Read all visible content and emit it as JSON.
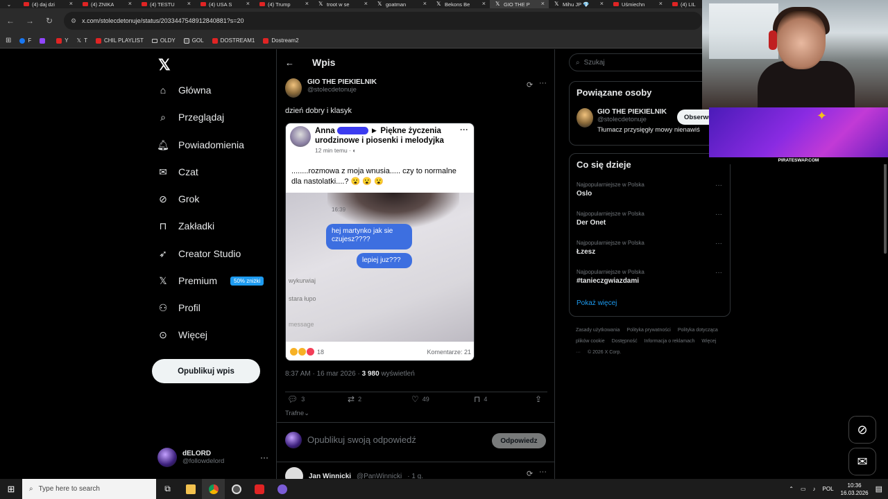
{
  "browser": {
    "tabs": [
      {
        "title": "(4) daj dzi",
        "icon": "youtube-icon"
      },
      {
        "title": "(4) ZNIKA",
        "icon": "youtube-icon"
      },
      {
        "title": "(4) TESTU",
        "icon": "youtube-icon"
      },
      {
        "title": "(4) USA S",
        "icon": "youtube-icon"
      },
      {
        "title": "(4) Trump",
        "icon": "youtube-icon"
      },
      {
        "title": "troot w se",
        "icon": "x-icon"
      },
      {
        "title": "goatman",
        "icon": "x-icon"
      },
      {
        "title": "Bekons Be",
        "icon": "x-icon"
      },
      {
        "title": "GIO THE P",
        "icon": "x-icon",
        "active": true
      },
      {
        "title": "Mihu JP 💎",
        "icon": "x-icon"
      },
      {
        "title": "Uśmiechn",
        "icon": "youtube-icon"
      },
      {
        "title": "(4) LIL",
        "icon": "youtube-icon"
      }
    ],
    "url": "x.com/stolecdetonuje/status/2033447548912840881?s=20",
    "bookmarks": [
      {
        "label": "F",
        "kind": "f"
      },
      {
        "label": "",
        "kind": "t"
      },
      {
        "label": "Y",
        "kind": "y"
      },
      {
        "label": "T",
        "kind": "x"
      },
      {
        "label": "CHIL PLAYLIST",
        "kind": "y"
      },
      {
        "label": "OLDY",
        "kind": "fold"
      },
      {
        "label": "GOL",
        "kind": "g"
      },
      {
        "label": "DOSTREAM1",
        "kind": "y"
      },
      {
        "label": "Dostream2",
        "kind": "y"
      }
    ]
  },
  "sidebar": {
    "items": [
      {
        "label": "Główna",
        "icon": "home-icon"
      },
      {
        "label": "Przeglądaj",
        "icon": "search-icon"
      },
      {
        "label": "Powiadomienia",
        "icon": "bell-icon"
      },
      {
        "label": "Czat",
        "icon": "mail-icon"
      },
      {
        "label": "Grok",
        "icon": "grok-icon"
      },
      {
        "label": "Zakładki",
        "icon": "bookmark-icon"
      },
      {
        "label": "Creator Studio",
        "icon": "rocket-icon"
      },
      {
        "label": "Premium",
        "icon": "x-icon",
        "badge": "50% zniżki"
      },
      {
        "label": "Profil",
        "icon": "person-icon"
      },
      {
        "label": "Więcej",
        "icon": "more-circle-icon"
      }
    ],
    "post_button": "Opublikuj wpis",
    "account": {
      "name": "dELORD",
      "handle": "@followdelord"
    }
  },
  "main": {
    "header_title": "Wpis",
    "post": {
      "author_name": "GIO THE PIEKIELNIK",
      "author_handle": "@stolecdetonuje",
      "text": "dzień dobry i klasyk",
      "embedded": {
        "fb_name": "Anna",
        "fb_group": "► Piękne życzenia urodzinowe i piosenki i melodyjka",
        "fb_time": "12 min temu · ◐",
        "fb_text": "........rozmowa z moja wnusia..... czy to normalne dla nastolatki....? 😮 😮 😮",
        "photo_time": "16:39",
        "bubble1": "hej martynko jak sie czujesz????",
        "bubble2": "lepiej juz???",
        "photo_line1": "wykurwiaj",
        "photo_line2": "stara  łupo",
        "photo_line3": "message",
        "reactions": "18",
        "comments": "Komentarze: 21"
      },
      "time": "8:37 AM · 16 mar 2026 ·",
      "views_count": "3 980",
      "views_label": "wyświetleń",
      "stats": {
        "replies": "3",
        "reposts": "2",
        "likes": "49",
        "bookmarks": "4"
      }
    },
    "sort_label": "Trafne",
    "reply_placeholder": "Opublikuj swoją odpowiedź",
    "reply_button": "Odpowiedz",
    "next_post": {
      "name": "Jan Winnicki",
      "handle": "@PanWinnicki",
      "time": "· 1 g."
    }
  },
  "right": {
    "search_placeholder": "Szukaj",
    "related_title": "Powiązane osoby",
    "related": {
      "name": "GIO THE PIEKIELNIK",
      "handle": "@stolecdetonuje",
      "bio": "Tłumacz przysięgły mowy nienawiś",
      "follow": "Obserwuj"
    },
    "trends_title": "Co się dzieje",
    "trends": [
      {
        "context": "Najpopularniejsze w Polska",
        "name": "Oslo"
      },
      {
        "context": "Najpopularniejsze w Polska",
        "name": "Der Onet"
      },
      {
        "context": "Najpopularniejsze w Polska",
        "name": "Łzesz"
      },
      {
        "context": "Najpopularniejsze w Polska",
        "name": "#tanieczgwiazdami"
      }
    ],
    "show_more": "Pokaż więcej",
    "footer_links": [
      "Zasady użytkowania",
      "Polityka prywatności",
      "Polityka dotycząca plików cookie",
      "Dostępność",
      "Informacja o reklamach",
      "Więcej ···",
      "© 2026 X Corp."
    ]
  },
  "overlay_label": "PIRATESWAP.COM",
  "taskbar": {
    "search_placeholder": "Type here to search",
    "lang": "POL",
    "time": "10:36",
    "date": "16.03.2026"
  },
  "colors": {
    "accent": "#1d9bf0",
    "background": "#000000",
    "border": "#2f3336"
  }
}
